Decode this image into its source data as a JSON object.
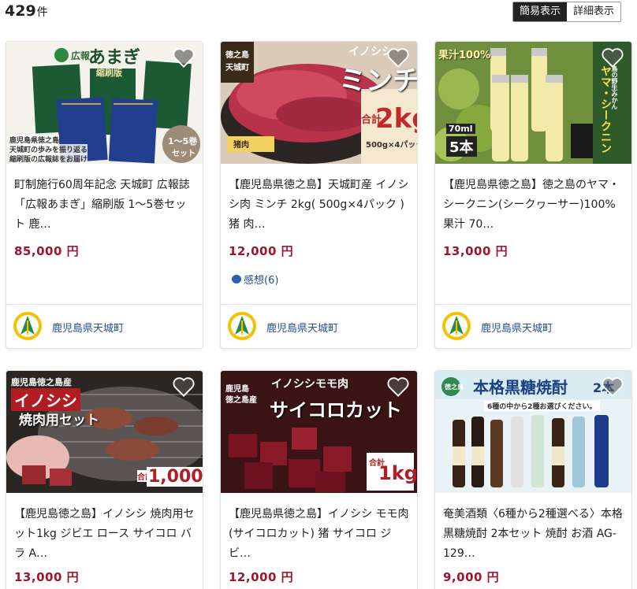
{
  "result": {
    "count": "429",
    "unit": "件"
  },
  "view_toggle": {
    "simple": "簡易表示",
    "detail": "詳細表示"
  },
  "colors": {
    "price": "#a1142a",
    "link": "#1f4e94",
    "active_toggle": "#222222"
  },
  "cards": [
    {
      "title": "町制施行60周年記念 天城町 広報誌「広報あまぎ」縮刷版 1～5巻セット 鹿…",
      "price": "85,000 円",
      "town": "鹿児島県天城町",
      "image_text": {
        "a": "広報",
        "b": "あまぎ",
        "c": "縮刷版",
        "d": "1～5巻",
        "e": "セット",
        "f": "鹿児島県徳之島",
        "g": "天城町の歩みを振り返る",
        "h": "縮刷版の広報誌をお届け"
      }
    },
    {
      "title": "【鹿児島県徳之島】天城町産 イノシシ肉 ミンチ 2kg( 500g×4パック )猪 肉…",
      "price": "12,000 円",
      "review": "感想(6)",
      "town": "鹿児島県天城町",
      "image_text": {
        "a": "徳之島",
        "b": "天城町",
        "c": "イノシシ",
        "d": "ミンチ",
        "e": "合計",
        "f": "2kg",
        "g": "500g×4パック",
        "h": "猪肉"
      }
    },
    {
      "title": "【鹿児島県徳之島】徳之島のヤマ・シークニン(シークヮーサー)100%果汁 70…",
      "price": "13,000 円",
      "town": "鹿児島県天城町",
      "image_text": {
        "a": "果汁100%",
        "b": "ヤマ・シークニン",
        "c": "70ml",
        "d": "5本",
        "e": "島の野生みかん"
      }
    },
    {
      "title": "【鹿児島徳之島】イノシシ 焼肉用セット1kg ジビエ ロース サイコロ バラ A…",
      "price": "13,000 円",
      "image_text": {
        "a": "鹿児島徳之島産",
        "b": "イノシシ",
        "c": "焼肉用セット",
        "d": "合計",
        "e": "1,000g"
      }
    },
    {
      "title": "【鹿児島県徳之島】イノシシ モモ肉 (サイコロカット) 猪 サイコロ ジビ…",
      "price": "12,000 円",
      "image_text": {
        "a": "鹿児島",
        "b": "徳之島産",
        "c": "イノシシモモ肉",
        "d": "サイコロカット",
        "e": "合計",
        "f": "1kg"
      }
    },
    {
      "title": "奄美酒類〈6種から2種選べる〉本格 黒糖焼酎 2本セット 焼酎 お酒 AG-129…",
      "price": "9,000 円",
      "image_text": {
        "a": "徳之島",
        "b": "本格黒糖焼酎",
        "c": "2本",
        "d": "6種の中から2種お選びください。"
      }
    }
  ]
}
